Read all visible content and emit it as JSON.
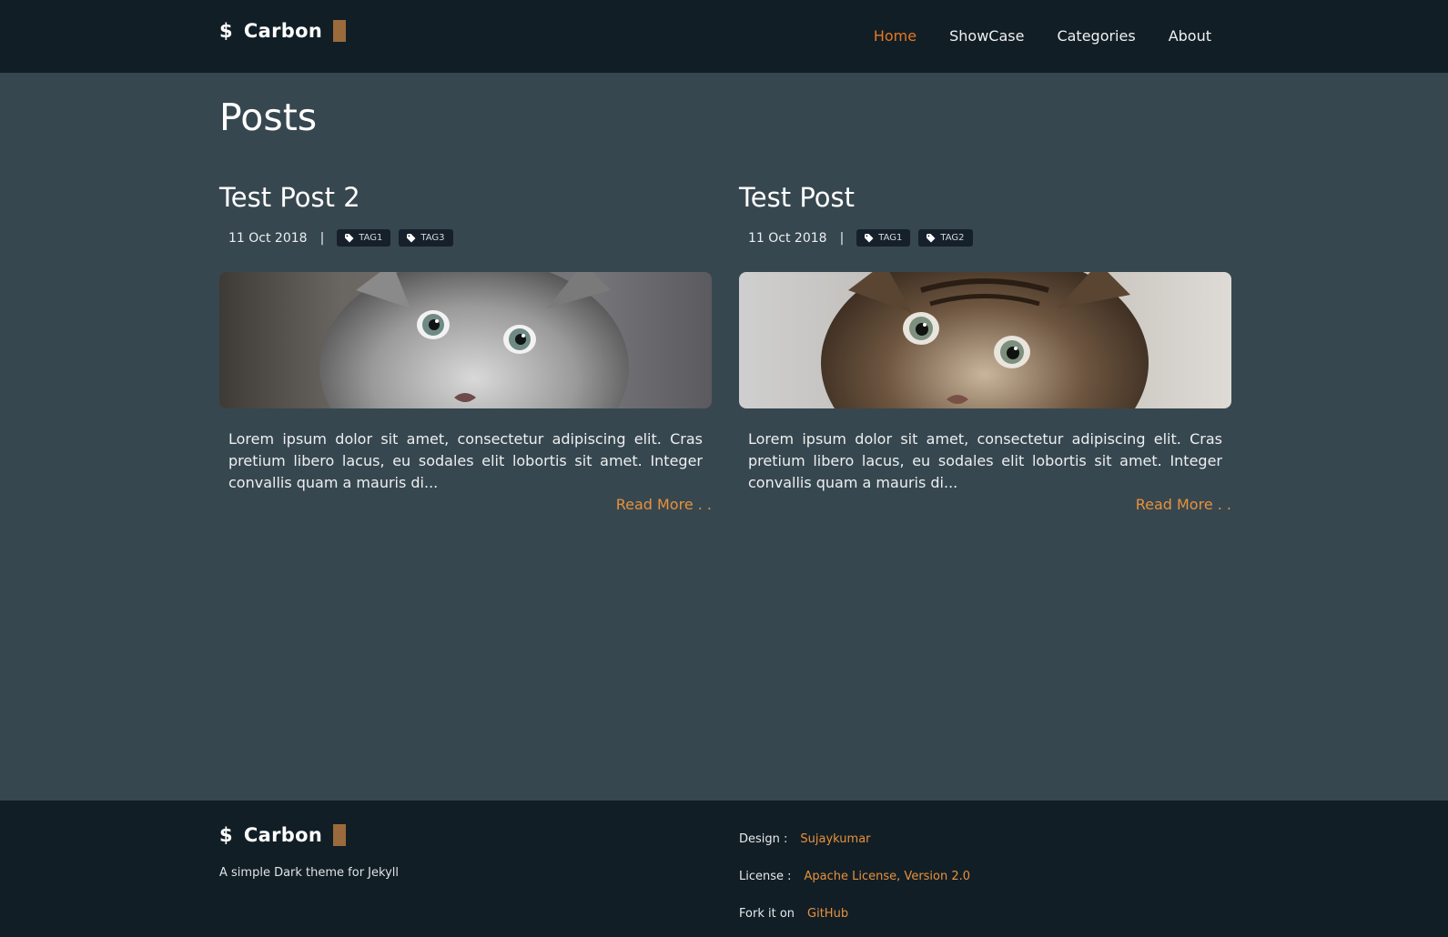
{
  "brand": {
    "prompt": "$",
    "name": "Carbon",
    "cursor_color": "#9a6a3c"
  },
  "nav": {
    "items": [
      {
        "label": "Home",
        "active": true
      },
      {
        "label": "ShowCase",
        "active": false
      },
      {
        "label": "Categories",
        "active": false
      },
      {
        "label": "About",
        "active": false
      }
    ],
    "active_color": "#e87722"
  },
  "page": {
    "title": "Posts"
  },
  "posts": [
    {
      "title": "Test Post 2",
      "date": "11 Oct 2018",
      "separator": "|",
      "tags": [
        "TAG1",
        "TAG3"
      ],
      "image": "grey-kitten-photo",
      "excerpt": "Lorem ipsum dolor sit amet, consectetur adipiscing elit. Cras pretium libero lacus, eu sodales elit lobortis sit amet. Integer convallis quam a mauris di...",
      "read_more": "Read More . ."
    },
    {
      "title": "Test Post",
      "date": "11 Oct 2018",
      "separator": "|",
      "tags": [
        "TAG1",
        "TAG2"
      ],
      "image": "tabby-kitten-photo",
      "excerpt": "Lorem ipsum dolor sit amet, consectetur adipiscing elit. Cras pretium libero lacus, eu sodales elit lobortis sit amet. Integer convallis quam a mauris di...",
      "read_more": "Read More . ."
    }
  ],
  "footer": {
    "tagline": "A simple Dark theme for Jekyll",
    "design_label": "Design :",
    "design_value": "Sujaykumar",
    "license_label": "License :",
    "license_value": "Apache License, Version 2.0",
    "fork_label": "Fork it on",
    "fork_value": "GitHub"
  },
  "colors": {
    "background": "#37474f",
    "header": "#111e26",
    "accent": "#e8913b"
  }
}
